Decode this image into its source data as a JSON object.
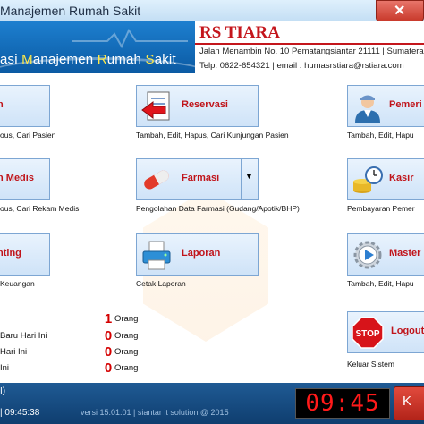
{
  "window": {
    "title": "Manajemen Rumah Sakit",
    "close_glyph": "✕"
  },
  "banner": {
    "app_title_parts": [
      "asi ",
      "M",
      "anajemen ",
      "R",
      "umah ",
      "S",
      "akit"
    ],
    "hospital_name": "RS TIARA",
    "address": "Jalan Menambin No. 10 Pematangsiantar 21111 | Sumatera",
    "contact": "Telp. 0622-654321 | email : humasrstiara@rstiara.com"
  },
  "tiles": {
    "pasien": {
      "label": "n",
      "caption": "ous, Cari Pasien"
    },
    "reservasi": {
      "label": "Reservasi",
      "caption": "Tambah, Edit, Hapus, Cari Kunjungan Pasien",
      "icon": "clipboard-arrow-icon"
    },
    "pemeriksaan": {
      "label": "Pemeri",
      "caption": "Tambah, Edit, Hapu",
      "icon": "doctor-icon"
    },
    "rekam_medis": {
      "label": "n Medis",
      "caption": "ous, Cari Rekam Medis"
    },
    "farmasi": {
      "label": "Farmasi",
      "caption": "Pengolahan Data Farmasi (Gudang/Apotik/BHP)",
      "icon": "capsule-icon",
      "dropdown": "▼"
    },
    "kasir": {
      "label": "Kasir",
      "caption": "Pembayaran Pemer",
      "icon": "coins-clock-icon"
    },
    "accounting": {
      "label": "nting",
      "caption": "Keuangan"
    },
    "laporan": {
      "label": "Laporan",
      "caption": "Cetak Laporan",
      "icon": "printer-icon"
    },
    "master": {
      "label": "Master",
      "caption": "Tambah, Edit, Hapu",
      "icon": "gear-play-icon"
    },
    "logout": {
      "label": "Logout",
      "caption": "Keluar Sistem",
      "icon": "stop-sign-icon",
      "stop_text": "STOP"
    }
  },
  "stats": [
    {
      "label": "",
      "value": "1",
      "unit": "Orang"
    },
    {
      "label": "Baru Hari Ini",
      "value": "0",
      "unit": "Orang"
    },
    {
      "label": "Hari Ini",
      "value": "0",
      "unit": "Orang"
    },
    {
      "label": "Ini",
      "value": "0",
      "unit": "Orang"
    }
  ],
  "status": {
    "left_top": "I)",
    "left_bottom": "| 09:45:38",
    "version": "versi 15.01.01 | siantar it solution @ 2015",
    "clock": "09:45",
    "right_button": "K"
  }
}
